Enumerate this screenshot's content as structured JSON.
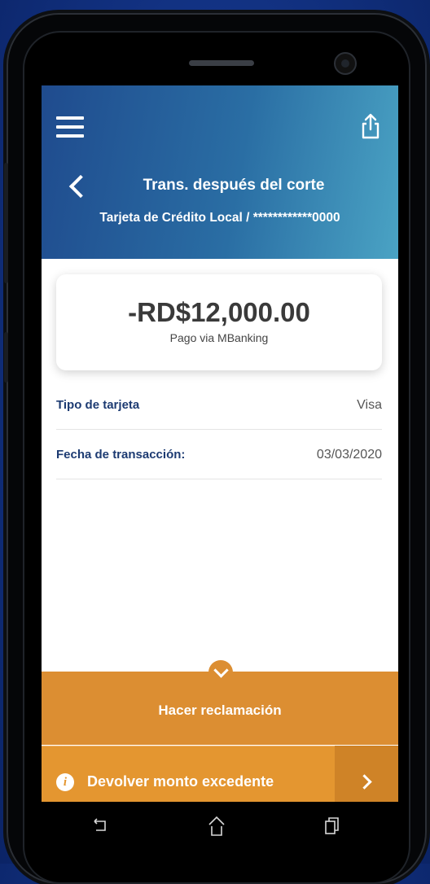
{
  "header": {
    "title": "Trans. después del corte",
    "subtitle": "Tarjeta de Crédito Local / ************0000"
  },
  "transaction": {
    "amount": "-RD$12,000.00",
    "description": "Pago via MBanking"
  },
  "details": [
    {
      "label": "Tipo de tarjeta",
      "value": "Visa"
    },
    {
      "label": "Fecha de transacción:",
      "value": "03/03/2020"
    }
  ],
  "actions": {
    "claim_label": "Hacer reclamación",
    "refund_label": "Devolver monto excedente"
  },
  "icons": {
    "menu": "menu-icon",
    "share": "share-icon",
    "back": "back-icon",
    "info": "info-icon",
    "android_back": "android-back-icon",
    "android_home": "android-home-icon",
    "android_recents": "android-recents-icon"
  },
  "colors": {
    "header_start": "#1f4b8e",
    "header_end": "#4aa3c4",
    "accent_orange": "#dc8e32",
    "label_blue": "#1d3b72"
  }
}
